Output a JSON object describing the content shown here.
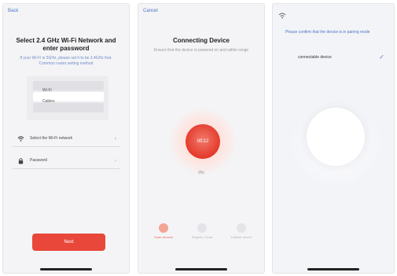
{
  "screen1": {
    "back_label": "Back",
    "title": "Select 2.4 GHz Wi-Fi Network and enter password",
    "subtitle": "If your Wi-Fi is 5GHz, please set it to be 2.4GHz first. Common router setting method",
    "networks": [
      "Wi-Fi",
      "Cables",
      ""
    ],
    "wifi_field_label": "Select the Wi-Fi network",
    "password_field_label": "Password",
    "next_label": "Next"
  },
  "screen2": {
    "back_label": "Cancel",
    "title": "Connecting Device",
    "subtitle": "Ensure that the device is powered on and within range",
    "pulse_label": "00:12",
    "progress_text": "0%",
    "steps": [
      "Scan devices",
      "Register Cloud",
      "Initialize device"
    ],
    "active_step": 0
  },
  "screen3": {
    "hint_link": "Please confirm that the device is in pairing mode",
    "device_name": "connectable device",
    "check_icon": "check-icon"
  },
  "colors": {
    "accent_red": "#e8473a",
    "link_blue": "#4a76c6",
    "background": "#f4f4f6"
  }
}
